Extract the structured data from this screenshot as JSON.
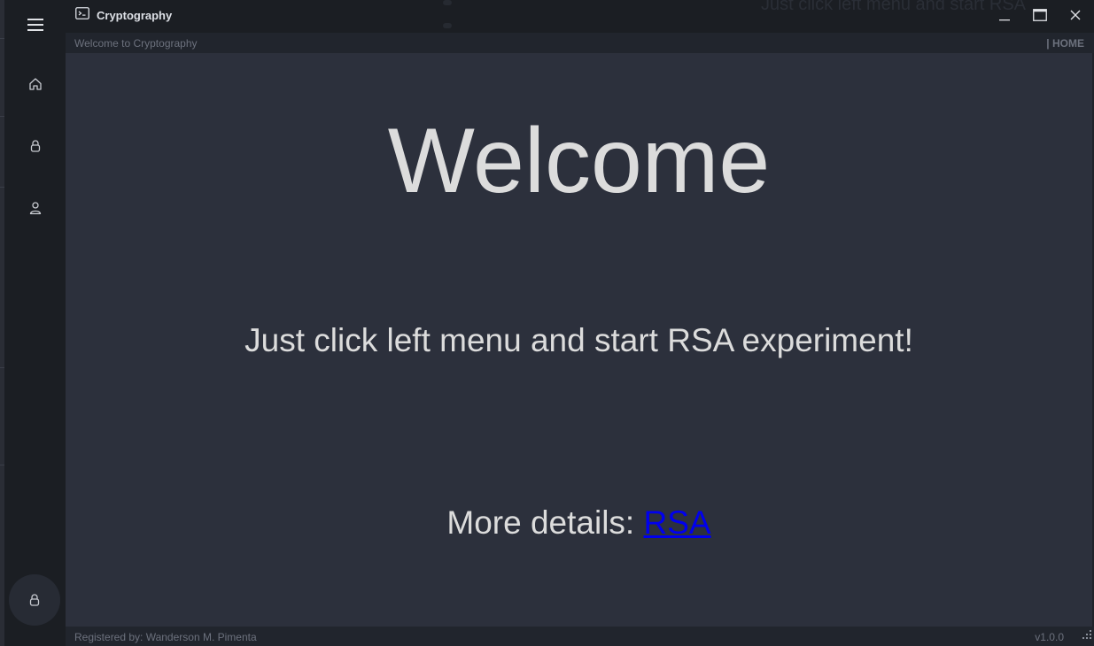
{
  "window": {
    "title": "Cryptography",
    "background_text": "Just click left menu and start RSA",
    "controls": {
      "minimize": "minimize",
      "maximize": "maximize",
      "close": "close"
    }
  },
  "sidebar": {
    "menu_icon": "hamburger-menu-icon",
    "items": [
      {
        "name": "home",
        "icon": "home-icon",
        "active": true
      },
      {
        "name": "encrypt",
        "icon": "lock-icon",
        "active": false
      },
      {
        "name": "user",
        "icon": "user-icon",
        "active": false
      }
    ],
    "bottom_button_icon": "lock-icon"
  },
  "infobar": {
    "left": "Welcome to Cryptography",
    "right": "| HOME"
  },
  "content": {
    "heading": "Welcome",
    "subtitle": "Just click left menu and start RSA experiment!",
    "details_label": "More details: ",
    "details_link": "RSA"
  },
  "statusbar": {
    "credits": "Registered by: Wanderson M. Pimenta",
    "version": "v1.0.0"
  },
  "colors": {
    "sidebar_bg": "#1b1e23",
    "content_bg": "#2c303c",
    "text": "#dcdcdc",
    "muted_text": "#6c717d",
    "link": "#0000ee"
  }
}
